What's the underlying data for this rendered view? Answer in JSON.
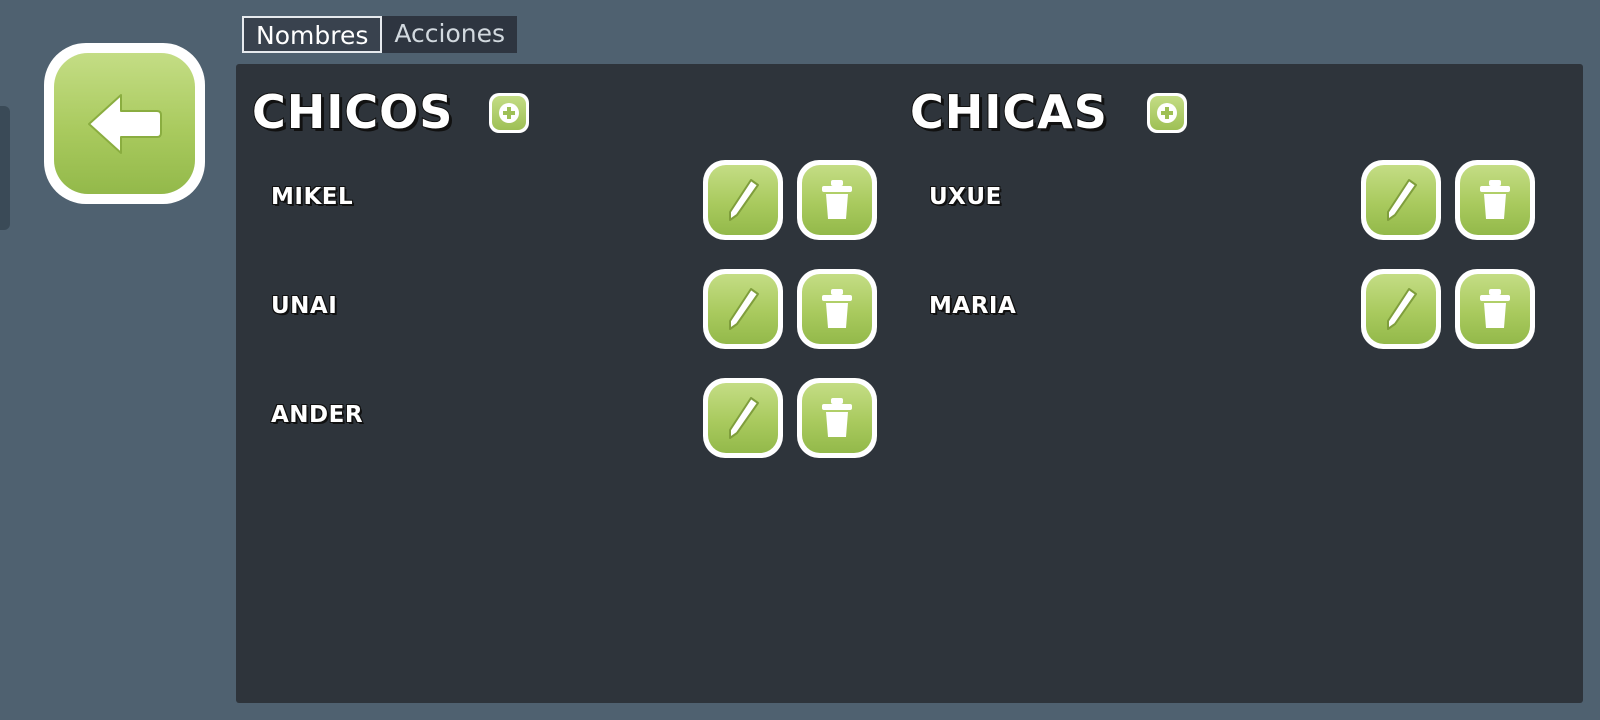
{
  "tabs": [
    {
      "label": "Nombres",
      "active": true
    },
    {
      "label": "Acciones",
      "active": false
    }
  ],
  "back_button": {
    "icon": "arrow-left-icon"
  },
  "boys": {
    "title": "CHICOS",
    "add_icon": "plus-icon",
    "items": [
      {
        "name": "MIKEL"
      },
      {
        "name": "UNAI"
      },
      {
        "name": "ANDER"
      }
    ]
  },
  "girls": {
    "title": "CHICAS",
    "add_icon": "plus-icon",
    "items": [
      {
        "name": "UXUE"
      },
      {
        "name": "MARIA"
      }
    ]
  },
  "icons": {
    "edit": "pencil-icon",
    "delete": "trash-icon"
  },
  "colors": {
    "background": "#4f6170",
    "panel": "#2e343b",
    "button_green": "#a9ca5e",
    "button_border": "#ffffff"
  }
}
